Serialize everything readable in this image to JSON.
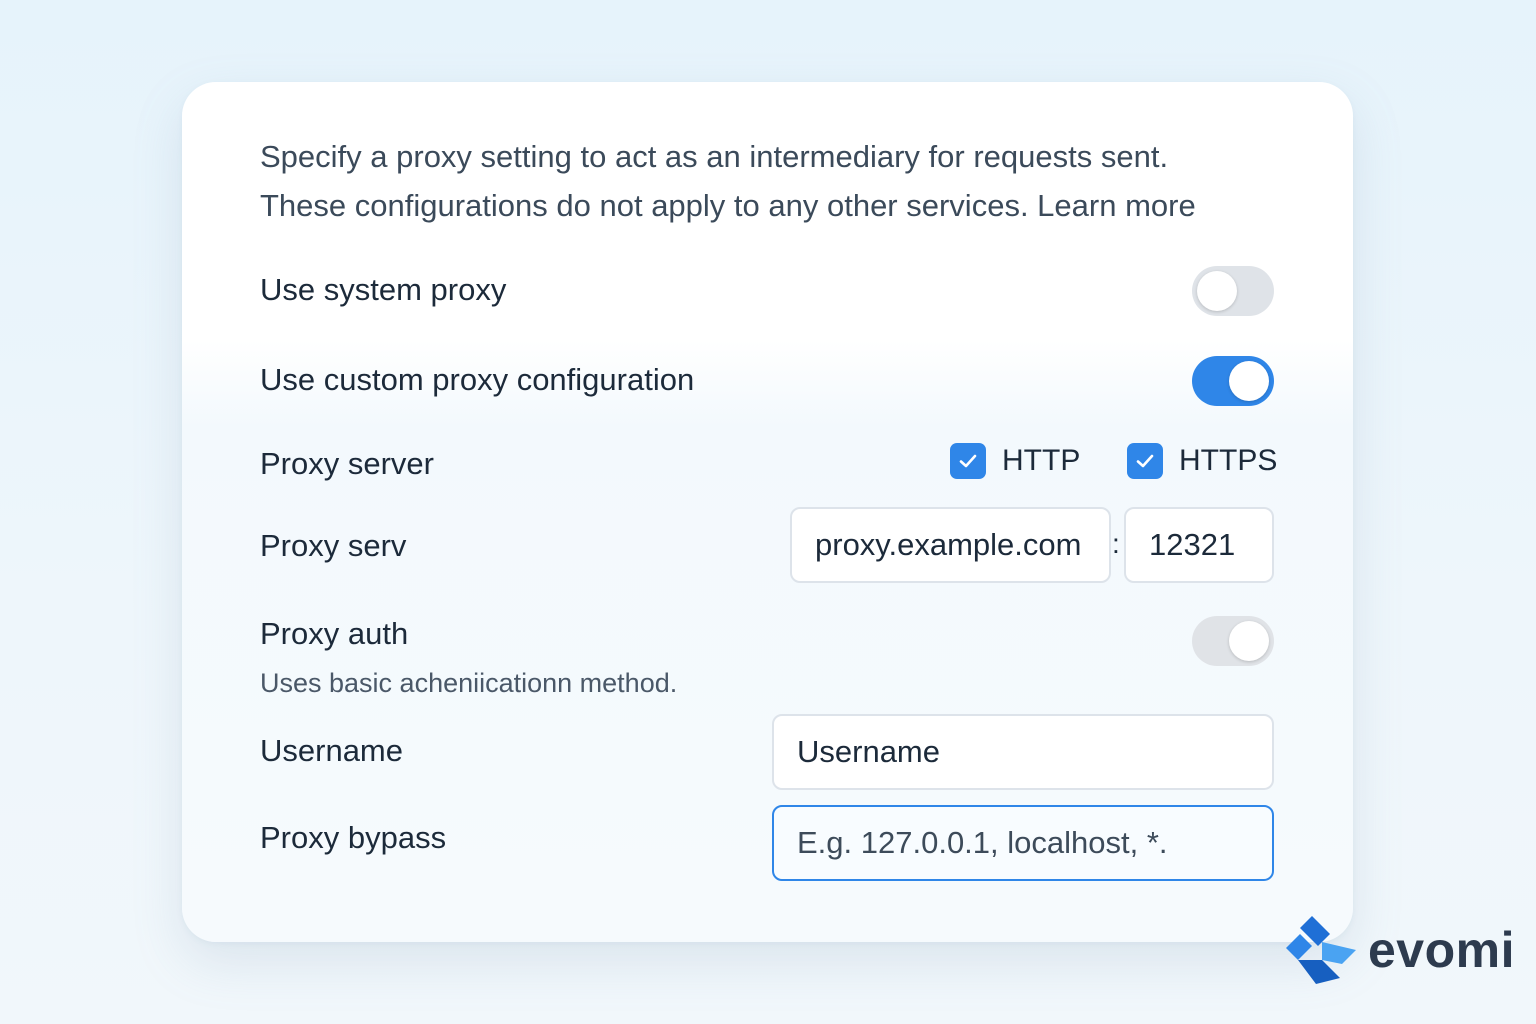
{
  "intro": {
    "line1": "Specify a proxy setting to act as an intermediary for requests sent.",
    "line2": "These configurations do not apply to any other services. Learn more"
  },
  "system_proxy": {
    "label": "Use system proxy",
    "enabled": false
  },
  "custom_proxy": {
    "label": "Use custom proxy configuration",
    "enabled": true
  },
  "proxy_server_protocols": {
    "label": "Proxy server",
    "http_label": "HTTP",
    "http_checked": true,
    "https_label": "HTTPS",
    "https_checked": true
  },
  "proxy_server_address": {
    "label": "Proxy serv",
    "host_value": "proxy.example.com",
    "separator": ":",
    "port_value": "12321"
  },
  "proxy_auth": {
    "label": "Proxy auth",
    "description": "Uses basic acheniicationn method.",
    "enabled": true
  },
  "username": {
    "label": "Username",
    "placeholder": "Username"
  },
  "proxy_bypass": {
    "label": "Proxy bypass",
    "placeholder": "E.g. 127.0.0.1, localhost, *."
  },
  "brand": {
    "name": "evomi",
    "icon": "evomi-logo-icon"
  },
  "colors": {
    "accent": "#2f86e8",
    "toggle_off": "#dfe3e8",
    "text_primary": "#1c2a3a",
    "text_secondary": "#3b4a5a"
  }
}
